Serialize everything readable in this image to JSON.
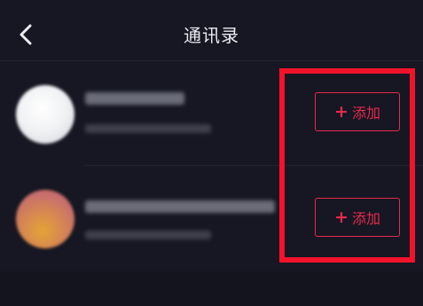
{
  "header": {
    "back_icon": "chevron-left-icon",
    "title": "通讯录"
  },
  "contacts": [
    {
      "add_label": "添加",
      "plus_icon": "plus-icon"
    },
    {
      "add_label": "添加",
      "plus_icon": "plus-icon"
    }
  ],
  "colors": {
    "background": "#161722",
    "accent": "#e8294d",
    "highlight": "#f2132b",
    "text": "#ececf2"
  }
}
